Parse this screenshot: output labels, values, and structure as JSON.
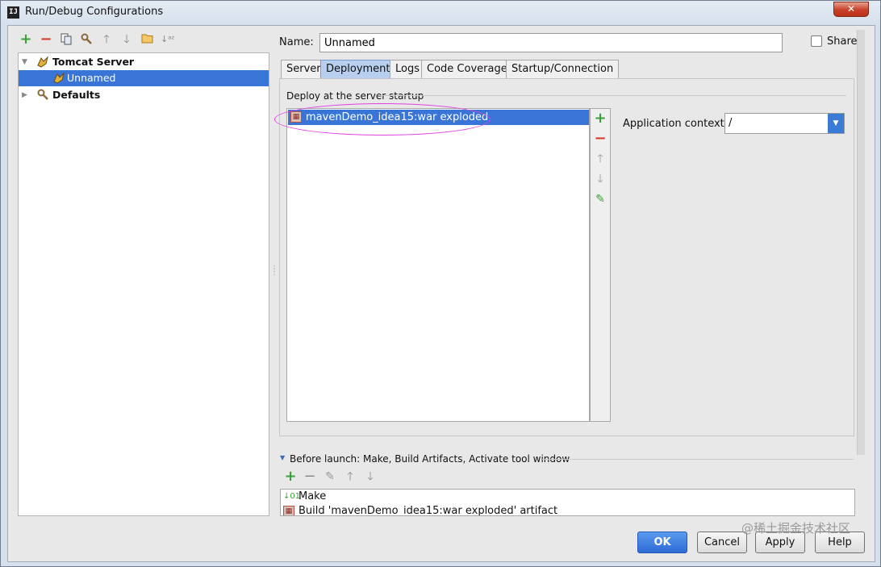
{
  "window": {
    "title": "Run/Debug Configurations",
    "app_icon": "IJ",
    "close_glyph": "✕"
  },
  "toolbar": {
    "icons": [
      "add-icon",
      "remove-icon",
      "copy-icon",
      "wrench-icon",
      "arrow-up-icon",
      "arrow-down-icon",
      "folder-icon",
      "sort-icon"
    ]
  },
  "tree": {
    "items": [
      {
        "label": "Tomcat Server",
        "expanded": true,
        "bold": true,
        "icon": "tomcat-icon"
      },
      {
        "label": "Unnamed",
        "selected": true,
        "icon": "tomcat-icon"
      },
      {
        "label": "Defaults",
        "expanded": false,
        "bold": true,
        "icon": "wrench-icon"
      }
    ]
  },
  "form": {
    "name_label": "Name:",
    "name_value": "Unnamed",
    "share_label": "Share",
    "share_checked": false
  },
  "tabs": [
    {
      "label": "Server"
    },
    {
      "label": "Deployment",
      "active": true
    },
    {
      "label": "Logs"
    },
    {
      "label": "Code Coverage"
    },
    {
      "label": "Startup/Connection"
    }
  ],
  "deployment": {
    "section_title": "Deploy at the server startup",
    "artifacts": [
      {
        "label": "mavenDemo_idea15:war exploded",
        "selected": true
      }
    ],
    "side_tools": [
      "add-icon",
      "remove-icon",
      "arrow-up-icon",
      "arrow-down-icon",
      "edit-icon"
    ],
    "app_context_label": "Application context:",
    "app_context_value": "/"
  },
  "before_launch": {
    "header": "Before launch: Make, Build Artifacts, Activate tool window",
    "tools": [
      "add-icon",
      "remove-icon",
      "edit-icon",
      "arrow-up-icon",
      "arrow-down-icon"
    ],
    "items": [
      {
        "label": "Make",
        "icon": "make-icon"
      },
      {
        "label": "Build 'mavenDemo_idea15:war exploded' artifact",
        "icon": "artifact-icon"
      }
    ]
  },
  "buttons": {
    "ok": "OK",
    "cancel": "Cancel",
    "apply": "Apply",
    "help": "Help"
  },
  "watermark": "@稀土掘金技术社区",
  "colors": {
    "selection": "#3875d6",
    "highlight_ellipse": "#e040e0",
    "add_green": "#3aa13a",
    "remove_red": "#d83a2a"
  }
}
